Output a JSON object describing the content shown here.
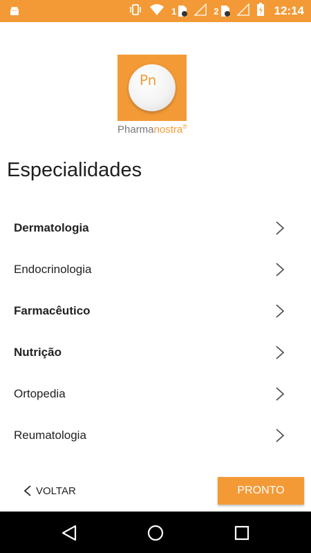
{
  "status_bar": {
    "sim1_label": "1",
    "sim2_label": "2",
    "time": "12:14",
    "icons": [
      "android-debug-icon",
      "vibrate-icon",
      "wifi-icon",
      "sim-card-icon",
      "signal-icon",
      "battery-icon"
    ]
  },
  "brand": {
    "monogram": "Pn",
    "name_part1": "Pharma",
    "name_part2": "nostra",
    "registered": "®",
    "accent_color": "#f39a37"
  },
  "page": {
    "title": "Especialidades"
  },
  "specialties": [
    {
      "label": "Dermatologia",
      "selected": true
    },
    {
      "label": "Endocrinologia",
      "selected": false
    },
    {
      "label": "Farmacêutico",
      "selected": true
    },
    {
      "label": "Nutrição",
      "selected": true
    },
    {
      "label": "Ortopedia",
      "selected": false
    },
    {
      "label": "Reumatologia",
      "selected": false
    }
  ],
  "actions": {
    "back_label": "VOLTAR",
    "done_label": "PRONTO"
  },
  "nav_bar": {
    "icons": [
      "back-icon",
      "home-icon",
      "recents-icon"
    ]
  }
}
